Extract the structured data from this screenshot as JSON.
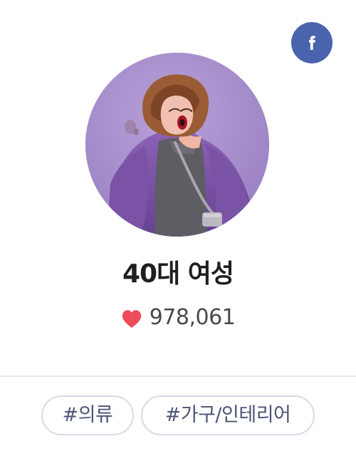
{
  "profile": {
    "name": "40대 여성",
    "likes": "978,061"
  },
  "icons": {
    "facebook": "facebook-icon",
    "heart": "heart-icon"
  },
  "tags": [
    "#의류",
    "#가구/인테리어"
  ],
  "colors": {
    "facebook": "#4a63ad",
    "heart": "#ef4b5c",
    "tag_border": "#d8dbe8",
    "tag_text": "#4d5477"
  }
}
